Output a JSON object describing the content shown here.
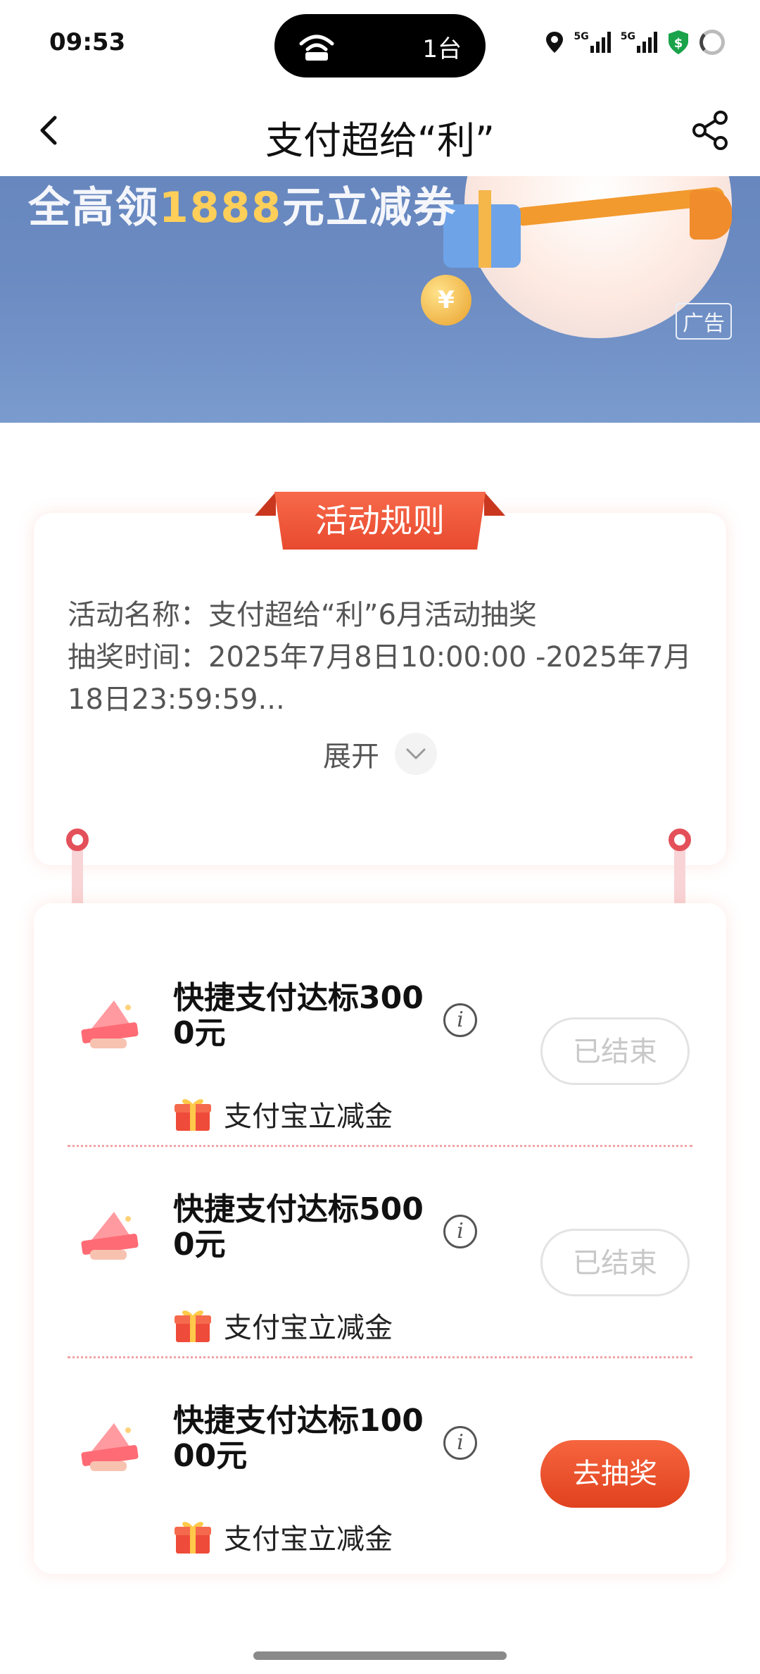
{
  "status_bar": {
    "time": "09:53",
    "island_count": "1台",
    "signal_labels": [
      "5G",
      "5G"
    ],
    "icons": [
      "wifi-hotspot-icon",
      "location-icon",
      "signal-icon",
      "signal-icon",
      "security-shield-icon",
      "loading-ring-icon"
    ]
  },
  "nav": {
    "title": "支付超给“利”",
    "back_icon": "chevron-left-icon",
    "share_icon": "share-icon"
  },
  "banner": {
    "text_prefix": "全高领",
    "text_amount": "1888",
    "text_suffix": "元立减券",
    "coin_symbol": "¥",
    "ad_label": "广告"
  },
  "rules": {
    "tab_label": "活动规则",
    "line1": "活动名称：支付超给“利”6月活动抽奖",
    "line2": "抽奖时间：2025年7月8日10:00:00 -2025年7月",
    "line3": "18日23:59:59...",
    "expand_label": "展开"
  },
  "tasks": [
    {
      "title": "快捷支付达标3000元",
      "reward": "支付宝立减金",
      "button": "已结束",
      "status": "ended"
    },
    {
      "title": "快捷支付达标5000元",
      "reward": "支付宝立减金",
      "button": "已结束",
      "status": "ended"
    },
    {
      "title": "快捷支付达标10000元",
      "reward": "支付宝立减金",
      "button": "去抽奖",
      "status": "active"
    }
  ],
  "colors": {
    "accent": "#e84a2f",
    "pin": "#e4505a",
    "divider": "#f1a3a7",
    "banner": "#5f7fb8"
  }
}
